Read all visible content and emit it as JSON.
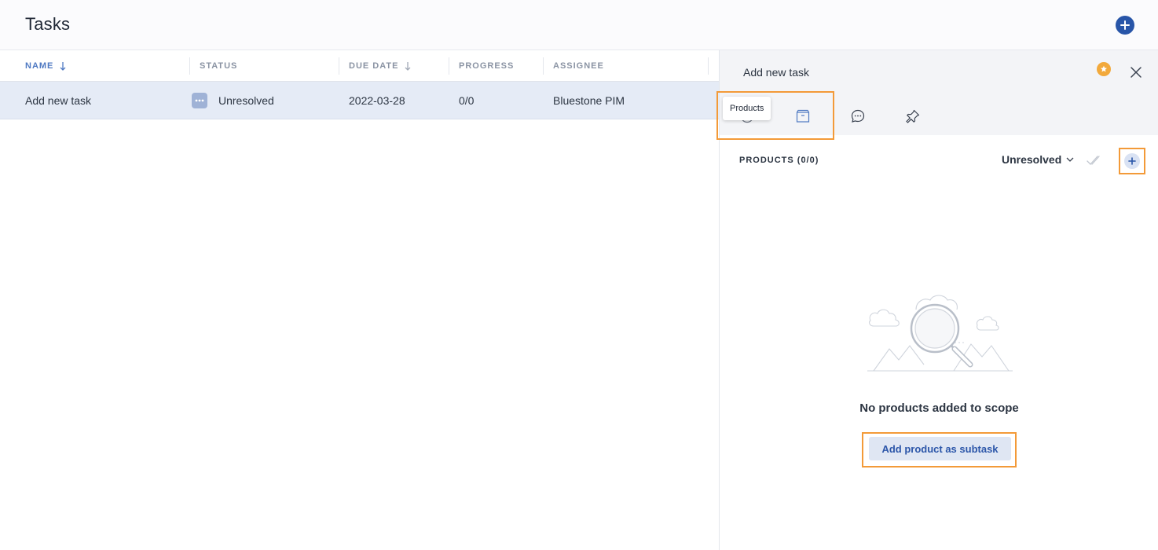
{
  "header": {
    "title": "Tasks"
  },
  "table": {
    "columns": [
      {
        "label": "NAME"
      },
      {
        "label": "STATUS"
      },
      {
        "label": "DUE DATE"
      },
      {
        "label": "PROGRESS"
      },
      {
        "label": "ASSIGNEE"
      }
    ],
    "rows": [
      {
        "name": "Add new task",
        "status": "Unresolved",
        "due_date": "2022-03-28",
        "progress": "0/0",
        "assignee": "Bluestone PIM"
      }
    ]
  },
  "panel": {
    "title": "Add new task",
    "tooltip": "Products",
    "section_title": "PRODUCTS (0/0)",
    "filter_value": "Unresolved",
    "empty_message": "No products added to scope",
    "cta_label": "Add product as subtask"
  },
  "colors": {
    "accent": "#2855a8",
    "highlight": "#f39a38",
    "star": "#f2a93b",
    "row_selected": "#e5ebf6"
  }
}
